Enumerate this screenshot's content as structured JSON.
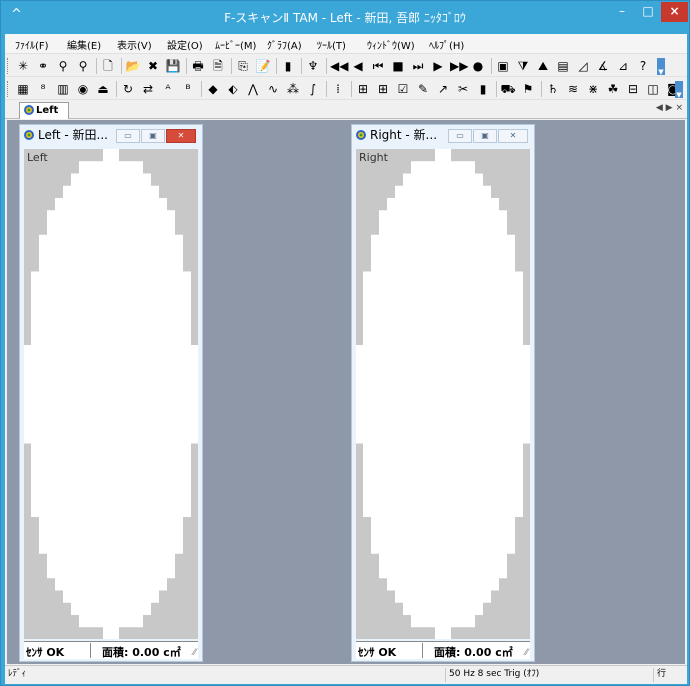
{
  "window": {
    "title": "F-スキャンⅡ TAM - Left - 新田, 吾郎 ﾆｯﾀｺﾞﾛｳ",
    "system_icon": "caret-up-icon",
    "min_label": "–",
    "max_label": "□",
    "close_label": "×",
    "colors": {
      "titlebar": "#3ba6d8",
      "close": "#c7392c",
      "mdi_background": "#8e98a8"
    }
  },
  "menu": {
    "items": [
      {
        "label": "ﾌｧｲﾙ(F)"
      },
      {
        "label": "編集(E)"
      },
      {
        "label": "表示(V)"
      },
      {
        "label": "設定(O)"
      },
      {
        "label": "ﾑｰﾋﾞｰ(M)"
      },
      {
        "label": "ｸﾞﾗﾌ(A)"
      },
      {
        "label": "ﾂｰﾙ(T)"
      },
      {
        "label": "ｳｨﾝﾄﾞｳ(W)"
      },
      {
        "label": "ﾍﾙﾌﾟ(H)"
      }
    ]
  },
  "toolbar1": {
    "buttons": [
      {
        "icon": "sparkle-icon",
        "glyph": "✳"
      },
      {
        "icon": "node-icon",
        "glyph": "⚭"
      },
      {
        "icon": "zoom-icon",
        "glyph": "⚲"
      },
      {
        "icon": "zoom-color-icon",
        "glyph": "⚲"
      },
      {
        "icon": "new-file-icon",
        "glyph": "🗋"
      },
      {
        "icon": "open-folder-icon",
        "glyph": "📂"
      },
      {
        "icon": "delete-icon",
        "glyph": "✖"
      },
      {
        "icon": "save-icon",
        "glyph": "💾"
      },
      {
        "icon": "print-icon",
        "glyph": "🖶"
      },
      {
        "icon": "print-preview-icon",
        "glyph": "🗎"
      },
      {
        "icon": "copy-icon",
        "glyph": "⎘"
      },
      {
        "icon": "notes-icon",
        "glyph": "📝"
      },
      {
        "icon": "scale-icon",
        "glyph": "▮"
      },
      {
        "icon": "sensor-icon",
        "glyph": "♆"
      },
      {
        "icon": "rewind-icon",
        "glyph": "◀◀"
      },
      {
        "icon": "step-back-icon",
        "glyph": "◀"
      },
      {
        "icon": "first-frame-icon",
        "glyph": "⏮"
      },
      {
        "icon": "stop-icon",
        "glyph": "■"
      },
      {
        "icon": "last-frame-icon",
        "glyph": "⏭"
      },
      {
        "icon": "play-icon",
        "glyph": "▶"
      },
      {
        "icon": "fast-forward-icon",
        "glyph": "▶▶"
      },
      {
        "icon": "record-icon",
        "glyph": "●"
      },
      {
        "icon": "camera-icon",
        "glyph": "▣"
      },
      {
        "icon": "filter-icon",
        "glyph": "⧩"
      },
      {
        "icon": "peaks-icon",
        "glyph": "⛰"
      },
      {
        "icon": "book-icon",
        "glyph": "▤"
      },
      {
        "icon": "measure-icon",
        "glyph": "◿"
      },
      {
        "icon": "angle-icon",
        "glyph": "∡"
      },
      {
        "icon": "chart-icon",
        "glyph": "⊿"
      },
      {
        "icon": "help-icon",
        "glyph": "?"
      }
    ]
  },
  "toolbar2": {
    "buttons": [
      {
        "icon": "grid-color-icon",
        "glyph": "▦"
      },
      {
        "icon": "numeric-icon",
        "glyph": "⁸"
      },
      {
        "icon": "contour-icon",
        "glyph": "▥"
      },
      {
        "icon": "center-of-force-icon",
        "glyph": "◉"
      },
      {
        "icon": "force-trajectory-icon",
        "glyph": "⏏"
      },
      {
        "icon": "rotate-icon",
        "glyph": "↻"
      },
      {
        "icon": "swap-icon",
        "glyph": "⇄"
      },
      {
        "icon": "abc-1-icon",
        "glyph": "ᴬ"
      },
      {
        "icon": "abc-2-icon",
        "glyph": "ᴮ"
      },
      {
        "icon": "diamond-icon",
        "glyph": "◆"
      },
      {
        "icon": "drop-icon",
        "glyph": "⬖"
      },
      {
        "icon": "line-icon",
        "glyph": "⋀"
      },
      {
        "icon": "wave-icon",
        "glyph": "∿"
      },
      {
        "icon": "pattern-icon",
        "glyph": "⁂"
      },
      {
        "icon": "integral-icon",
        "glyph": "∫"
      },
      {
        "icon": "separator-grid-icon",
        "glyph": "⁞"
      },
      {
        "icon": "table-icon",
        "glyph": "⊞"
      },
      {
        "icon": "gridview-icon",
        "glyph": "⊞"
      },
      {
        "icon": "graph-check-icon",
        "glyph": "☑"
      },
      {
        "icon": "graph-icon",
        "glyph": "✎"
      },
      {
        "icon": "axis-icon",
        "glyph": "↗"
      },
      {
        "icon": "cut-icon",
        "glyph": "✂"
      },
      {
        "icon": "bars-icon",
        "glyph": "▮"
      },
      {
        "icon": "car-icon",
        "glyph": "⛟"
      },
      {
        "icon": "walk-icon",
        "glyph": "⚑"
      },
      {
        "icon": "sensor-map-icon",
        "glyph": "♄"
      },
      {
        "icon": "wave-2-icon",
        "glyph": "≋"
      },
      {
        "icon": "diff-icon",
        "glyph": "⋇"
      },
      {
        "icon": "leaf-icon",
        "glyph": "☘"
      },
      {
        "icon": "split-h-icon",
        "glyph": "⊟"
      },
      {
        "icon": "split-v-icon",
        "glyph": "◫"
      },
      {
        "icon": "snapshot-icon",
        "glyph": "◙"
      }
    ]
  },
  "tabs": {
    "active_label": "Left",
    "controls": "◀ ▶ ×"
  },
  "child_left": {
    "title": "Left - 新田...",
    "plot_label": "Left",
    "sensor_status": "ｾﾝｻ OK",
    "area_text": "面積: 0.00 c㎡"
  },
  "child_right": {
    "title": "Right - 新...",
    "plot_label": "Right",
    "sensor_status": "ｾﾝｻ OK",
    "area_text": "面積: 0.00 c㎡"
  },
  "statusbar": {
    "ready": "ﾚﾃﾞｨ",
    "trigger": "50 Hz 8 sec Trig (ｵﾌ)",
    "mode": "行"
  }
}
